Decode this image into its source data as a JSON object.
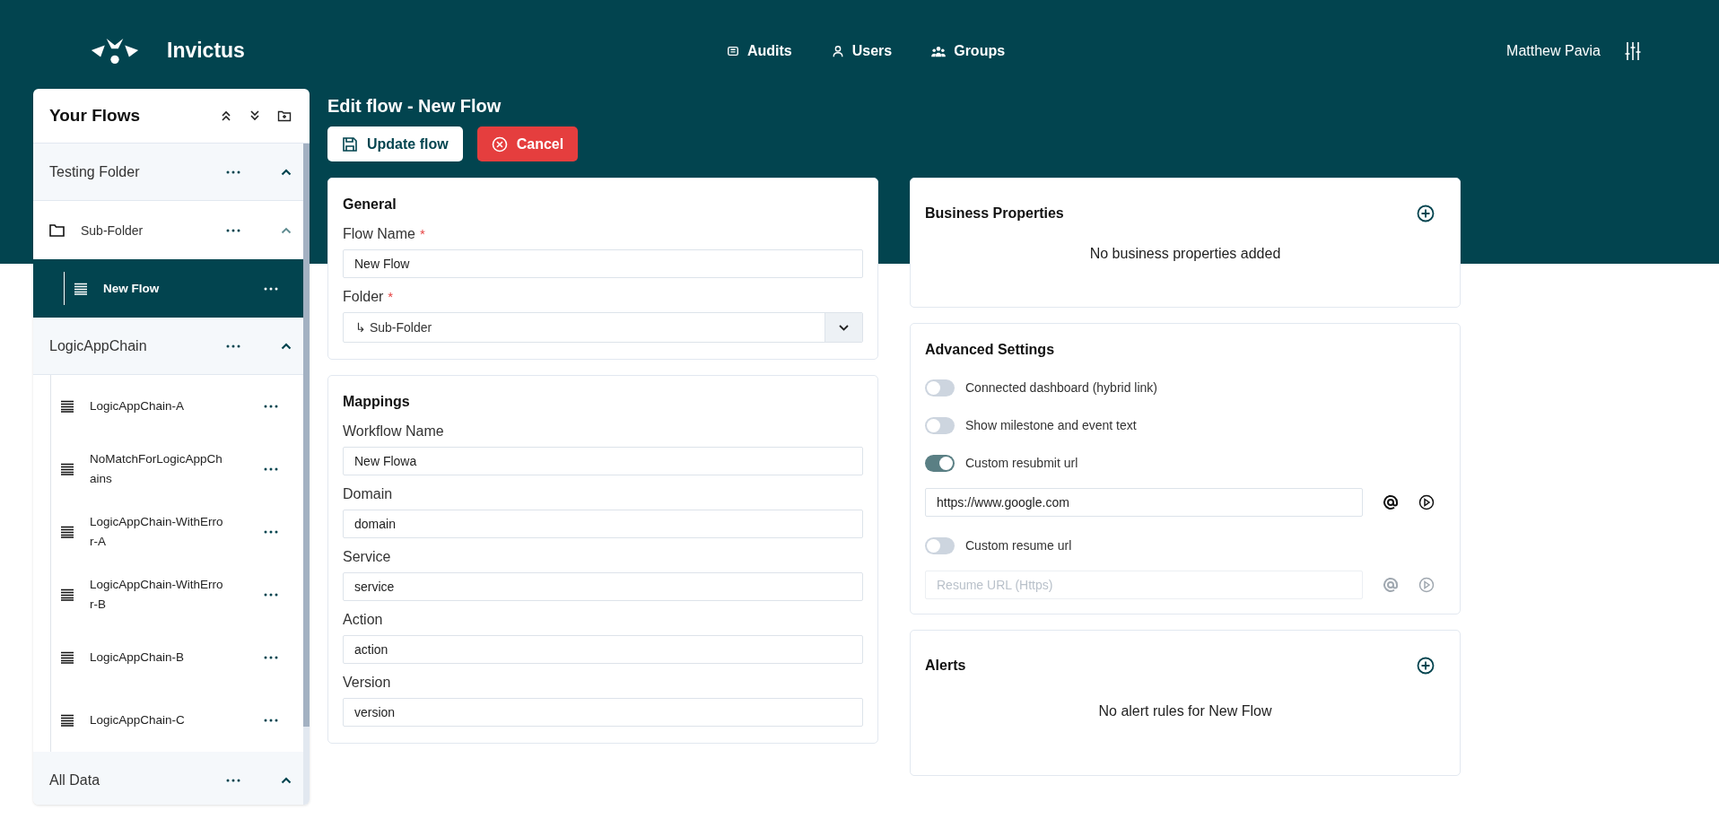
{
  "header": {
    "brand": "Invictus",
    "nav": [
      {
        "label": "Audits"
      },
      {
        "label": "Users"
      },
      {
        "label": "Groups"
      }
    ],
    "user": "Matthew Pavia"
  },
  "sidebar": {
    "title": "Your Flows",
    "folders": [
      {
        "label": "Testing Folder",
        "expanded": true,
        "children": [
          {
            "kind": "folder",
            "label": "Sub-Folder",
            "expanded": true,
            "children": [
              {
                "kind": "flow",
                "label": "New Flow",
                "selected": true
              }
            ]
          }
        ]
      },
      {
        "label": "LogicAppChain",
        "expanded": true,
        "children": [
          {
            "kind": "flow",
            "label": "LogicAppChain-A",
            "selected": false
          },
          {
            "kind": "flow",
            "label": "NoMatchForLogicAppChains",
            "selected": false
          },
          {
            "kind": "flow",
            "label": "LogicAppChain-WithError-A",
            "selected": false
          },
          {
            "kind": "flow",
            "label": "LogicAppChain-WithError-B",
            "selected": false
          },
          {
            "kind": "flow",
            "label": "LogicAppChain-B",
            "selected": false
          },
          {
            "kind": "flow",
            "label": "LogicAppChain-C",
            "selected": false
          }
        ]
      },
      {
        "label": "All Data",
        "expanded": true
      }
    ]
  },
  "page_title": "Edit flow - New Flow",
  "actions": [
    {
      "kind": "primary",
      "label": "Update flow"
    },
    {
      "kind": "danger",
      "label": "Cancel"
    }
  ],
  "general": {
    "title": "General",
    "fields": [
      {
        "kind": "text",
        "label": "Flow Name",
        "required_mark": "*",
        "value": "New Flow"
      },
      {
        "kind": "select",
        "label": "Folder",
        "required_mark": "*",
        "value": "↳ Sub-Folder"
      }
    ]
  },
  "mappings": {
    "title": "Mappings",
    "fields": [
      {
        "kind": "text",
        "label": "Workflow Name",
        "value": "New Flowa"
      },
      {
        "kind": "text",
        "label": "Domain",
        "value": "domain"
      },
      {
        "kind": "text",
        "label": "Service",
        "value": "service"
      },
      {
        "kind": "text",
        "label": "Action",
        "value": "action"
      },
      {
        "kind": "text",
        "label": "Version",
        "value": "version"
      }
    ]
  },
  "business_properties": {
    "title": "Business Properties",
    "empty_text": "No business properties added"
  },
  "advanced": {
    "title": "Advanced Settings",
    "items": [
      {
        "kind": "toggle",
        "label": "Connected dashboard (hybrid link)",
        "on": false
      },
      {
        "kind": "toggle",
        "label": "Show milestone and event text",
        "on": false
      },
      {
        "kind": "toggle",
        "label": "Custom resubmit url",
        "on": true
      },
      {
        "kind": "url",
        "value": "https://www.google.com",
        "disabled": false
      },
      {
        "kind": "toggle",
        "label": "Custom resume url",
        "on": false
      },
      {
        "kind": "url",
        "placeholder": "Resume URL (Https)",
        "disabled": true
      }
    ]
  },
  "alerts": {
    "title": "Alerts",
    "empty_text": "No alert rules for New Flow"
  }
}
